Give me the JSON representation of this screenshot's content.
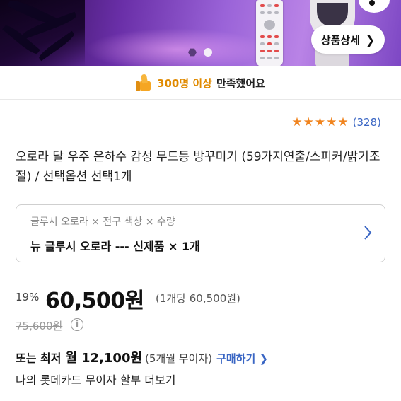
{
  "hero": {
    "detail_button_label": "상품상세",
    "detail_button_icon": "chevron-right-icon",
    "slide_count": 2,
    "active_slide": 1,
    "colors": {
      "banner_start": "#2a0a4a",
      "banner_mid": "#9a63d8"
    }
  },
  "satisfaction": {
    "icon": "thumbs-up-icon",
    "highlight": "300명 이상",
    "text": "만족했어요"
  },
  "rating": {
    "stars": 5,
    "count_text": "(328)",
    "star_color": "#f0841f"
  },
  "product": {
    "title": "오로라 달 우주 은하수 감성 무드등 방꾸미기 (59가지연출/스피커/밝기조절) / 선택옵션 선택1개"
  },
  "option": {
    "label": "글루시 오로라 × 전구 색상 × 수량",
    "value": "뉴 글루시 오로라 --- 신제품 × 1개"
  },
  "price": {
    "discount": "19%",
    "sale_price": "60,500원",
    "unit_price": "(1개당 60,500원)",
    "original_price": "75,600원"
  },
  "installment": {
    "prefix": "또는 최저",
    "month_label": "월",
    "monthly_amount": "12,100원",
    "terms": "(5개월 무이자)",
    "buy_link": "구매하기",
    "buy_link_icon": "chevron-right-icon",
    "card_link": "나의 롯데카드 무이자 할부 더보기",
    "link_color": "#3a66c4"
  }
}
